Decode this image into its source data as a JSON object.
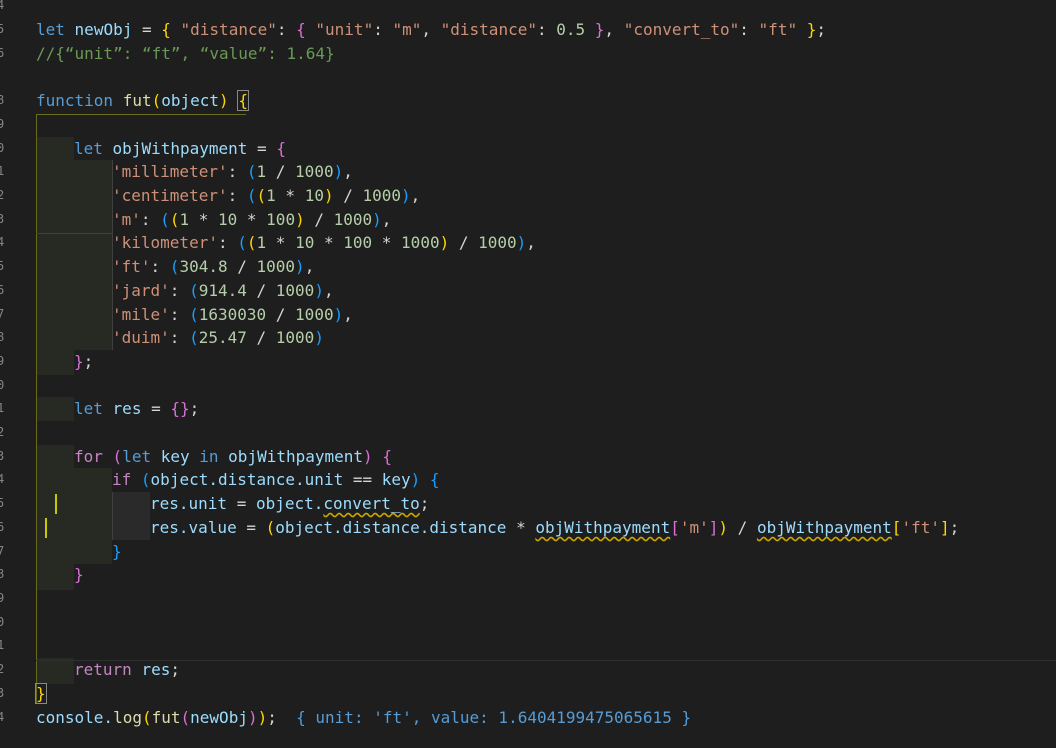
{
  "line_numbers": [
    "4",
    "5",
    "6",
    "",
    "8",
    "9",
    "0",
    "1",
    "2",
    "3",
    "4",
    "5",
    "6",
    "7",
    "8",
    "9",
    "0",
    "1",
    "2",
    "3",
    "4",
    "5",
    "6",
    "7",
    "8",
    "9",
    "0",
    "1",
    "2",
    "3",
    "4"
  ],
  "code": {
    "l01": {
      "kw": "let",
      "var": "newObj",
      "rest_open": " = ",
      "b_open": "{",
      "s1": " \"distance\"",
      "c1": ": ",
      "b2_open": "{",
      "s2": " \"unit\"",
      "c2": ": ",
      "s3": "\"m\"",
      "c3": ", ",
      "s4": "\"distance\"",
      "c4": ": ",
      "n1": "0.5",
      "sp": " ",
      "b2_close": "}",
      "c5": ", ",
      "s5": "\"convert_to\"",
      "c6": ": ",
      "s6": "\"ft\"",
      "sp2": " ",
      "b_close": "}",
      "semi": ";"
    },
    "l02": {
      "comment": "//{“unit”: “ft”, “value”: 1.64}"
    },
    "l04": {
      "kw": "function",
      "fn": "fut",
      "p_open": "(",
      "param": "object",
      "p_close": ")",
      "sp": " ",
      "b_open": "{"
    },
    "l06": {
      "kw": "let",
      "var": "objWithpayment",
      "eq": " = ",
      "b_open": "{"
    },
    "l07": {
      "key": "'millimeter'",
      "colon": ": ",
      "p": "(",
      "n1": "1",
      "op": " / ",
      "n2": "1000",
      "pc": ")",
      "comma": ","
    },
    "l08": {
      "key": "'centimeter'",
      "colon": ": ",
      "p1": "(",
      "p2": "(",
      "n1": "1",
      "op1": " * ",
      "n2": "10",
      "p2c": ")",
      "op2": " / ",
      "n3": "1000",
      "p1c": ")",
      "comma": ","
    },
    "l09": {
      "key": "'m'",
      "colon": ": ",
      "p1": "(",
      "p2": "(",
      "n1": "1",
      "op1": " * ",
      "n2": "10",
      "op2": " * ",
      "n3": "100",
      "p2c": ")",
      "op3": " / ",
      "n4": "1000",
      "p1c": ")",
      "comma": ","
    },
    "l10": {
      "key": "'kilometer'",
      "colon": ": ",
      "p1": "(",
      "p2": "(",
      "n1": "1",
      "op1": " * ",
      "n2": "10",
      "op2": " * ",
      "n3": "100",
      "op3": " * ",
      "n4": "1000",
      "p2c": ")",
      "op4": " / ",
      "n5": "1000",
      "p1c": ")",
      "comma": ","
    },
    "l11": {
      "key": "'ft'",
      "colon": ": ",
      "p": "(",
      "n1": "304.8",
      "op": " / ",
      "n2": "1000",
      "pc": ")",
      "comma": ","
    },
    "l12": {
      "key": "'jard'",
      "colon": ": ",
      "p": "(",
      "n1": "914.4",
      "op": " / ",
      "n2": "1000",
      "pc": ")",
      "comma": ","
    },
    "l13": {
      "key": "'mile'",
      "colon": ": ",
      "p": "(",
      "n1": "1630030",
      "op": " / ",
      "n2": "1000",
      "pc": ")",
      "comma": ","
    },
    "l14": {
      "key": "'duim'",
      "colon": ": ",
      "p": "(",
      "n1": "25.47",
      "op": " / ",
      "n2": "1000",
      "pc": ")"
    },
    "l15": {
      "b_close": "}",
      "semi": ";"
    },
    "l17": {
      "kw": "let",
      "var": "res",
      "eq": " = ",
      "b": "{}",
      "semi": ";"
    },
    "l19": {
      "kw": "for",
      "sp": " ",
      "p": "(",
      "kw2": "let",
      "sp2": " ",
      "var": "key",
      "kw3": " in ",
      "var2": "objWithpayment",
      "pc": ")",
      "sp3": " ",
      "b_open": "{"
    },
    "l20": {
      "kw": "if",
      "sp": " ",
      "p": "(",
      "var": "object.distance.unit",
      "op": " == ",
      "var2": "key",
      "pc": ")",
      "sp2": " ",
      "b_open": "{"
    },
    "l21": {
      "var": "res.unit",
      "op": " = ",
      "var2": "object.",
      "var3": "convert_to",
      "semi": ";"
    },
    "l22": {
      "var": "res.value",
      "op": " = ",
      "p": "(",
      "var2": "object.distance.distance",
      "op2": " * ",
      "var3": "objWithpayment",
      "br": "[",
      "str": "'m'",
      "brc": "]",
      "pc": ")",
      "op3": " / ",
      "var4": "objWithpayment",
      "br2": "[",
      "str2": "'ft'",
      "brc2": "]",
      "semi": ";"
    },
    "l23": {
      "b_close": "}"
    },
    "l24": {
      "b_close": "}"
    },
    "l28": {
      "kw": "return",
      "sp": " ",
      "var": "res",
      "semi": ";"
    },
    "l29": {
      "b_close": "}"
    },
    "l30": {
      "var": "console.",
      "fn": "log",
      "p": "(",
      "fn2": "fut",
      "p2": "(",
      "var2": "newObj",
      "p2c": ")",
      "pc": ")",
      "semi": ";",
      "output": "  { unit: 'ft', value: 1.6404199475065615 }"
    }
  }
}
